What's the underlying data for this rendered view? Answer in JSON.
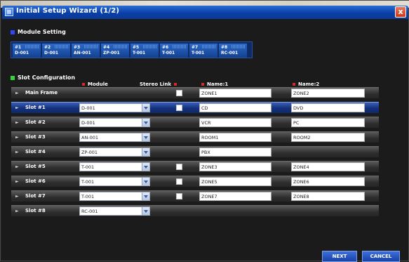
{
  "window": {
    "title": "Initial Setup Wizard (1/2)",
    "close_label": "x"
  },
  "module_setting": {
    "heading": "Module Setting",
    "modules": [
      {
        "num": "#1",
        "model": "D-001"
      },
      {
        "num": "#2",
        "model": "D-001"
      },
      {
        "num": "#3",
        "model": "AN-001"
      },
      {
        "num": "#4",
        "model": "ZP-001"
      },
      {
        "num": "#5",
        "model": "T-001"
      },
      {
        "num": "#6",
        "model": "T-001"
      },
      {
        "num": "#7",
        "model": "T-001"
      },
      {
        "num": "#8",
        "model": "RC-001"
      }
    ]
  },
  "slot_configuration": {
    "heading": "Slot Configuration",
    "columns": {
      "module": "Module",
      "stereo_link": "Stereo Link",
      "name1": "Name:1",
      "name2": "Name:2"
    },
    "rows": [
      {
        "label": "Main Frame",
        "module": "",
        "stereo": true,
        "name1": "ZONE1",
        "name2": "ZONE2"
      },
      {
        "label": "Slot #1",
        "module": "D-001",
        "stereo": true,
        "name1": "CD",
        "name2": "DVD"
      },
      {
        "label": "Slot #2",
        "module": "D-001",
        "stereo": false,
        "name1": "VCR",
        "name2": "PC"
      },
      {
        "label": "Slot #3",
        "module": "AN-001",
        "stereo": false,
        "name1": "ROOM1",
        "name2": "ROOM2"
      },
      {
        "label": "Slot #4",
        "module": "ZP-001",
        "stereo": false,
        "name1": "PBX",
        "name2": ""
      },
      {
        "label": "Slot #5",
        "module": "T-001",
        "stereo": true,
        "name1": "ZONE3",
        "name2": "ZONE4"
      },
      {
        "label": "Slot #6",
        "module": "T-001",
        "stereo": true,
        "name1": "ZONE5",
        "name2": "ZONE6"
      },
      {
        "label": "Slot #7",
        "module": "T-001",
        "stereo": true,
        "name1": "ZONE7",
        "name2": "ZONE8"
      },
      {
        "label": "Slot #8",
        "module": "RC-001",
        "stereo": false,
        "name1": "",
        "name2": ""
      }
    ],
    "selected_row": 1
  },
  "buttons": {
    "next": "NEXT",
    "cancel": "CANCEL"
  },
  "colors": {
    "accent_blue": "#1742a8",
    "required_mark": "#d8282a",
    "module_marker": "#2f45ff",
    "slot_marker": "#35d23a"
  }
}
